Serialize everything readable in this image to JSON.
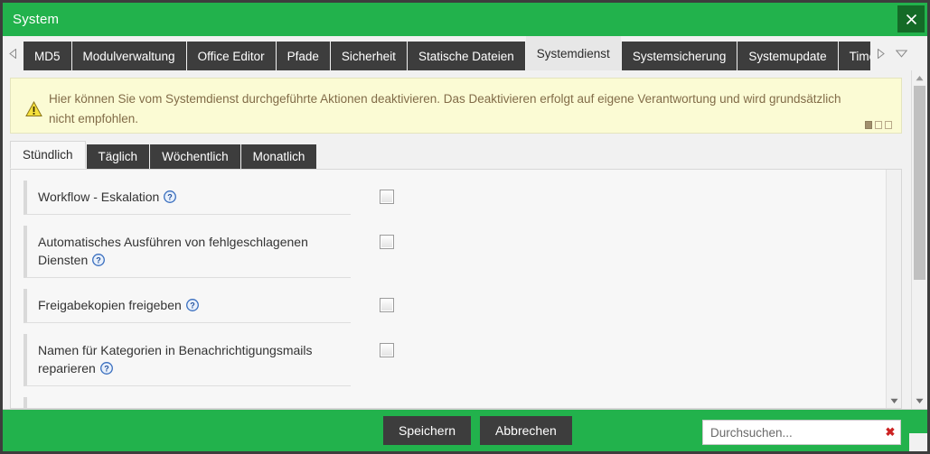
{
  "window": {
    "title": "System",
    "close_label": "close-icon",
    "accent_color": "#22b24c",
    "close_bg": "#146a27",
    "dark_color": "#3d3d3d"
  },
  "tabstrip": {
    "scroll_left_icon": "triangle-left-icon",
    "scroll_right_icon": "triangle-right-icon",
    "dropdown_icon": "chevron-down-icon",
    "tabs": [
      {
        "label": "MD5",
        "active": false
      },
      {
        "label": "Modulverwaltung",
        "active": false
      },
      {
        "label": "Office Editor",
        "active": false
      },
      {
        "label": "Pfade",
        "active": false
      },
      {
        "label": "Sicherheit",
        "active": false
      },
      {
        "label": "Statische Dateien",
        "active": false
      },
      {
        "label": "Systemdienst",
        "active": true
      },
      {
        "label": "Systemsicherung",
        "active": false
      },
      {
        "label": "Systemupdate",
        "active": false
      },
      {
        "label": "Timer",
        "active": false
      }
    ]
  },
  "warning": {
    "icon": "warning-triangle-icon",
    "text": "Hier können Sie vom Systemdienst durchgeführte Aktionen deaktivieren. Das Deaktivieren erfolgt auf eigene Verantwortung und wird grundsätzlich nicht empfohlen.",
    "pager": {
      "total": 3,
      "current": 1
    },
    "bg_color": "#fbfbd4",
    "text_color": "#826c48"
  },
  "subtabs": [
    {
      "label": "Stündlich",
      "active": true
    },
    {
      "label": "Täglich",
      "active": false
    },
    {
      "label": "Wöchentlich",
      "active": false
    },
    {
      "label": "Monatlich",
      "active": false
    }
  ],
  "rows": [
    {
      "label": "Workflow - Eskalation",
      "help": "help-icon",
      "checked": false
    },
    {
      "label": "Automatisches Ausführen von fehlgeschlagenen Diensten",
      "help": "help-icon",
      "checked": false
    },
    {
      "label": "Freigabekopien freigeben",
      "help": "help-icon",
      "checked": false
    },
    {
      "label": "Namen für Kategorien in Benachrichtigungsmails reparieren",
      "help": "help-icon",
      "checked": false
    }
  ],
  "footer": {
    "save_label": "Speichern",
    "cancel_label": "Abbrechen",
    "search_placeholder": "Durchsuchen...",
    "search_value": "",
    "search_clear_icon": "clear-x-icon"
  },
  "scrollbars": {
    "up_icon": "triangle-up-icon",
    "down_icon": "triangle-down-icon"
  }
}
